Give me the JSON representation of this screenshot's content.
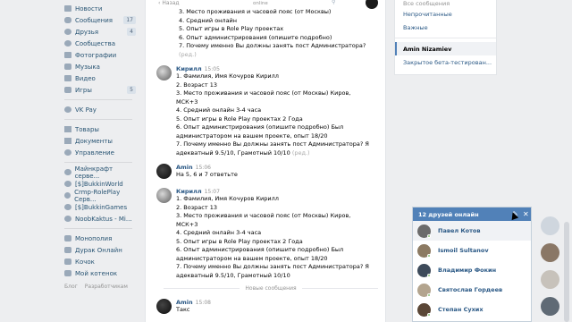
{
  "sidebar": {
    "items": [
      {
        "label": "Новости",
        "icon": "news-icon",
        "badge": ""
      },
      {
        "label": "Сообщения",
        "icon": "messages-icon",
        "badge": "17"
      },
      {
        "label": "Друзья",
        "icon": "friends-icon",
        "badge": "4"
      },
      {
        "label": "Сообщества",
        "icon": "communities-icon",
        "badge": ""
      },
      {
        "label": "Фотографии",
        "icon": "photos-icon",
        "badge": ""
      },
      {
        "label": "Музыка",
        "icon": "music-icon",
        "badge": ""
      },
      {
        "label": "Видео",
        "icon": "video-icon",
        "badge": ""
      },
      {
        "label": "Игры",
        "icon": "games-icon",
        "badge": "5"
      }
    ],
    "pay": "VK Pay",
    "services": [
      "Товары",
      "Документы",
      "Управление"
    ],
    "groups": [
      "Майнкрафт серве...",
      "[$]BukkinWorld",
      "Crmp-RolePlay Серв...",
      "[$]BukkinGames",
      "NoobKaktus - Mi..."
    ],
    "more": [
      "Монополия",
      "Дурак Онлайн",
      "Кочок",
      "Мой котенок"
    ],
    "footer": [
      "Блог",
      "Разработчикам"
    ]
  },
  "chat": {
    "back": "Назад",
    "online": "online",
    "new_messages": "Новые сообщения",
    "block0": {
      "lines": [
        "3. Место проживания и часовой пояс (от Москвы)",
        "4. Средний онлайн",
        "5. Опыт игры в Role Play проектах",
        "6. Опыт администрирования (опишите подробно)",
        "7. Почему именно Вы должны занять пост Администратора?"
      ],
      "edited": "(ред.)"
    },
    "msg1": {
      "author": "Кирилл",
      "time": "15:05",
      "lines": [
        "1. Фамилия, Имя Кочуров Кирилл",
        "2. Возраст 13",
        "3. Место проживания и часовой пояс (от Москвы) Киров,",
        "МСК+3",
        "4. Средний онлайн 3-4 часа",
        "5. Опыт игры в Role Play проектах 2 Года",
        "6. Опыт администрирования (опишите подробно) Был",
        "администратором на вашем проекте, опыт 18/20",
        "7. Почему именно Вы должны занять пост Администратора? Я",
        "адекватный 9.5/10, Грамотный 10/10"
      ],
      "edited": "(ред.)"
    },
    "msg2": {
      "author": "Amin",
      "time": "15:06",
      "lines": [
        "На 5, 6 и 7 ответьте"
      ]
    },
    "msg3": {
      "author": "Кирилл",
      "time": "15:07",
      "lines": [
        "1. Фамилия, Имя Кочуров Кирилл",
        "2. Возраст 13",
        "3. Место проживания и часовой пояс (от Москвы) Киров,",
        "МСК+3",
        "4. Средний онлайн 3-4 часа",
        "5. Опыт игры в Role Play проектах 2 Года",
        "6. Опыт администрирования (опишите подробно) Был",
        "администратором на вашем проекте, опыт 18/20",
        "7. Почему именно Вы должны занять пост Администратора? Я",
        "адекватный 9.5/10, Грамотный 10/10"
      ]
    },
    "msg4": {
      "author": "Amin",
      "time": "15:08",
      "lines": [
        "Такс"
      ]
    }
  },
  "rmenu": {
    "items": [
      "Все сообщения",
      "Непрочитанные",
      "Важные"
    ],
    "active": "Amin Nizamiev",
    "beta": "Закрытое бета-тестирован..."
  },
  "friends": {
    "title": "12 друзей онлайн",
    "list": [
      "Павел Котов",
      "Ismoil Sultanov",
      "Владимир Фокин",
      "Святослав Гордеев",
      "Степан Сухих"
    ]
  },
  "colors": {
    "accent": "#5181b8",
    "link": "#2a5885",
    "online": "#8ac176"
  }
}
